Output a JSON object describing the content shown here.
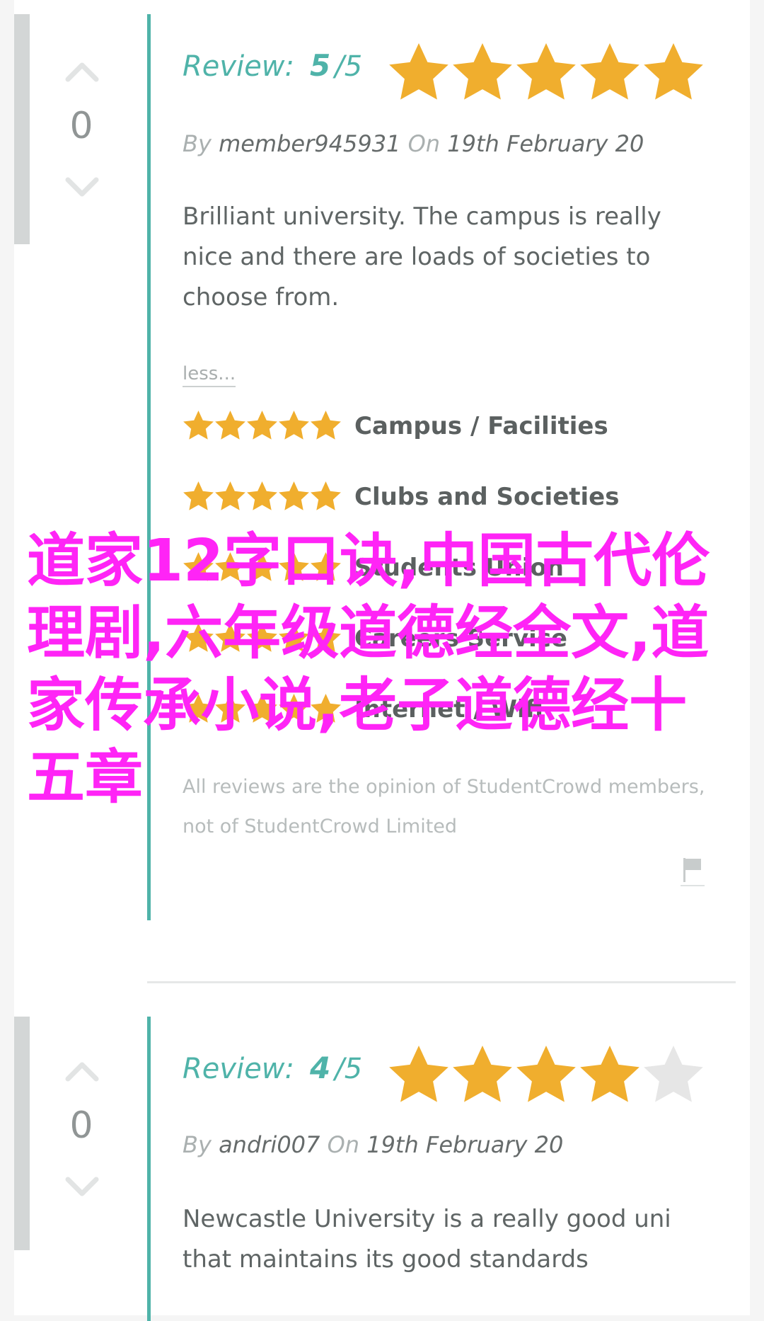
{
  "colors": {
    "accent": "#4fb3a9",
    "star_gold": "#f0ae2e",
    "star_empty": "#e6e6e6",
    "vote_bar": "#d3d6d6",
    "overlay_text": "#ff24f6"
  },
  "reviews": [
    {
      "votes": "0",
      "score_label": "Review:",
      "score": "5",
      "score_max": "/5",
      "rating": 5,
      "by_label": "By",
      "author": "member945931",
      "on_label": "On",
      "date": "19th February 20",
      "text": "Brilliant university. The campus is really nice and there are loads of societies to choose from.",
      "less": "less...",
      "categories": [
        {
          "label": "Campus / Facilities",
          "rating": 5
        },
        {
          "label": "Clubs and Societies",
          "rating": 5
        },
        {
          "label": "Students Union",
          "rating": 5
        },
        {
          "label": "Careers Service",
          "rating": 5
        },
        {
          "label": "Internet / Wifi",
          "rating": 5
        }
      ],
      "disclaimer": "All reviews are the opinion of StudentCrowd members, not of StudentCrowd Limited",
      "flag_icon": "flag-icon"
    },
    {
      "votes": "0",
      "score_label": "Review:",
      "score": "4",
      "score_max": "/5",
      "rating": 4,
      "by_label": "By",
      "author": "andri007",
      "on_label": "On",
      "date": "19th February 20",
      "text": "Newcastle University is a really good uni that maintains its good standards"
    }
  ],
  "overlay": {
    "text": "道家12字口诀,中国古代伦理剧,六年级道德经全文,道家传承小说,老子道德经十五章"
  },
  "icons": {
    "upvote": "chevron-up-icon",
    "downvote": "chevron-down-icon",
    "star": "star-icon",
    "flag": "flag-icon"
  }
}
